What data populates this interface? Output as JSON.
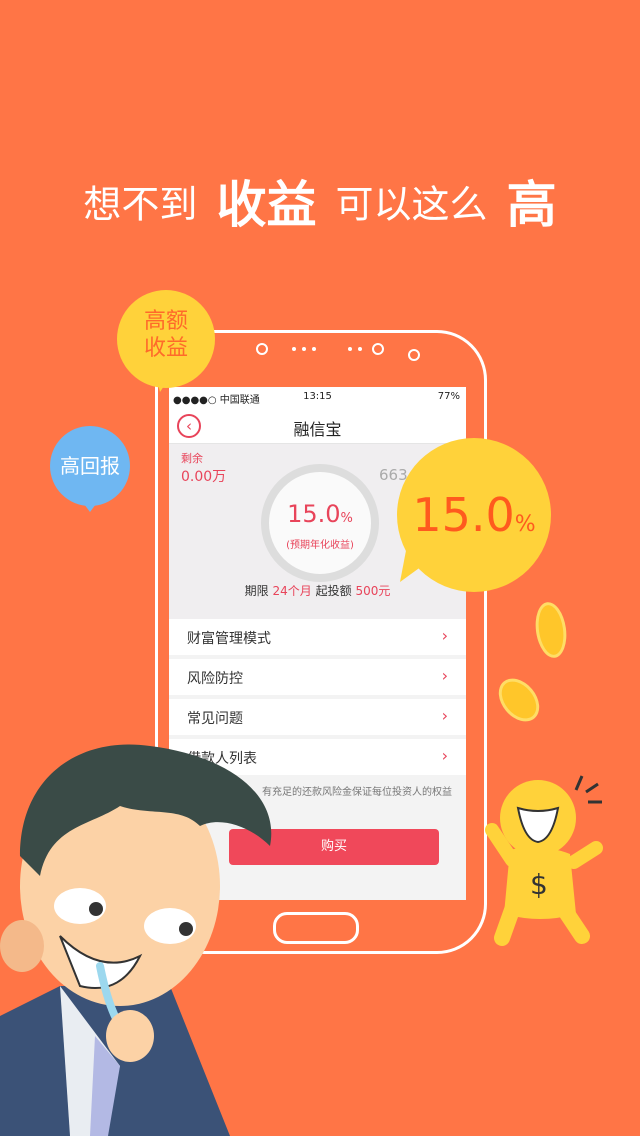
{
  "headline": {
    "p1": "想不到",
    "p2": "收益",
    "p3": "可以这么",
    "p4": "高"
  },
  "bubbles": {
    "high_amount_line1": "高额",
    "high_amount_line2": "收益",
    "high_return": "高回报",
    "big_rate": "15.0",
    "big_rate_unit": "%"
  },
  "status_bar": {
    "carrier": "●●●●○ 中国联通",
    "time": "13:15",
    "battery": "77%"
  },
  "nav": {
    "title": "融信宝"
  },
  "hero": {
    "remain_label": "剩余",
    "remain_value": "0.00万",
    "total_value": "663",
    "rate": "15.0",
    "rate_unit": "%",
    "rate_label": "(预期年化收益)",
    "term_label": "期限",
    "term_value": "24个月",
    "min_label": "起投额",
    "min_value": "500元"
  },
  "menu": [
    {
      "label": "财富管理模式"
    },
    {
      "label": "风险防控"
    },
    {
      "label": "常见问题"
    },
    {
      "label": "借款人列表"
    }
  ],
  "note": "有充足的还款风险金保证每位投资人的权益",
  "buy_label": "购买",
  "colors": {
    "background": "#ff7546",
    "accent": "#e8445a",
    "bubble_yellow": "#ffd23a",
    "bubble_blue": "#6fb7f2"
  }
}
